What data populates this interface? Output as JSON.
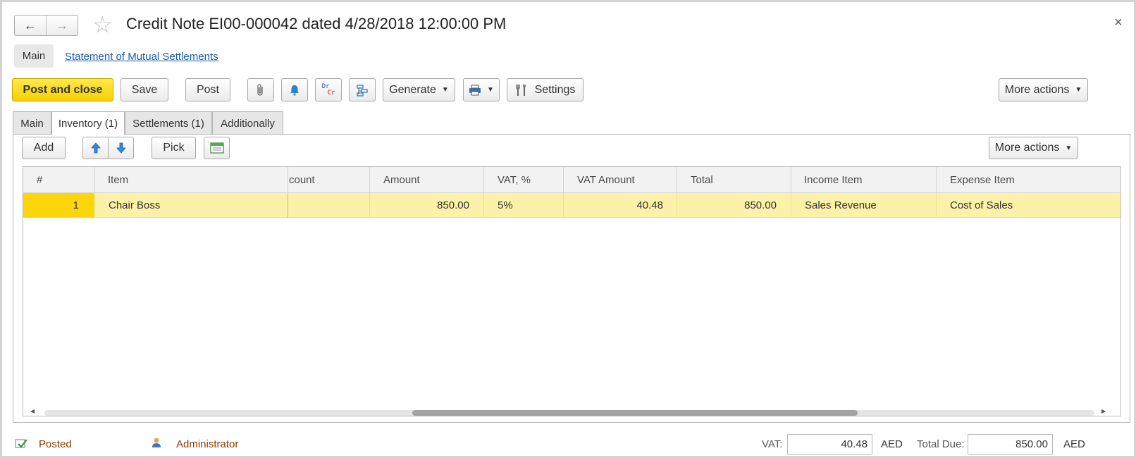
{
  "window": {
    "title": "Credit Note EI00-000042 dated 4/28/2018 12:00:00 PM",
    "back_label": "←",
    "forward_label": "→",
    "star_label": "☆",
    "close_label": "×"
  },
  "top_nav": {
    "main_label": "Main",
    "link_label": "Statement of Mutual Settlements"
  },
  "toolbar": {
    "post_close_label": "Post and close",
    "save_label": "Save",
    "post_label": "Post",
    "generate_label": "Generate",
    "settings_label": "Settings",
    "more_actions_label": "More actions",
    "drcr_top": "Dr",
    "drcr_bottom": "Cr"
  },
  "tabs": [
    {
      "label": "Main"
    },
    {
      "label": "Inventory (1)",
      "active": true
    },
    {
      "label": "Settlements (1)"
    },
    {
      "label": "Additionally"
    }
  ],
  "grid_toolbar": {
    "add_label": "Add",
    "pick_label": "Pick",
    "more_actions_label": "More actions"
  },
  "table": {
    "columns": [
      "#",
      "Item",
      "count",
      "Amount",
      "VAT, %",
      "VAT Amount",
      "Total",
      "Income Item",
      "Expense Item"
    ],
    "rows": [
      {
        "num": "1",
        "item": "Chair Boss",
        "count": "",
        "amount": "850.00",
        "vat_pct": "5%",
        "vat_amount": "40.48",
        "total": "850.00",
        "income_item": "Sales Revenue",
        "expense_item": "Cost of Sales"
      }
    ]
  },
  "footer": {
    "status": "Posted",
    "user": "Administrator",
    "vat_label": "VAT:",
    "vat_value": "40.48",
    "currency1": "AED",
    "total_due_label": "Total Due:",
    "total_due_value": "850.00",
    "currency2": "AED"
  },
  "colors": {
    "primary_button": "#f5d000",
    "selected_row": "#fbf1a8",
    "row_number_cell": "#fcd50a",
    "link": "#1a5ca8",
    "status": "#8a3c00"
  }
}
